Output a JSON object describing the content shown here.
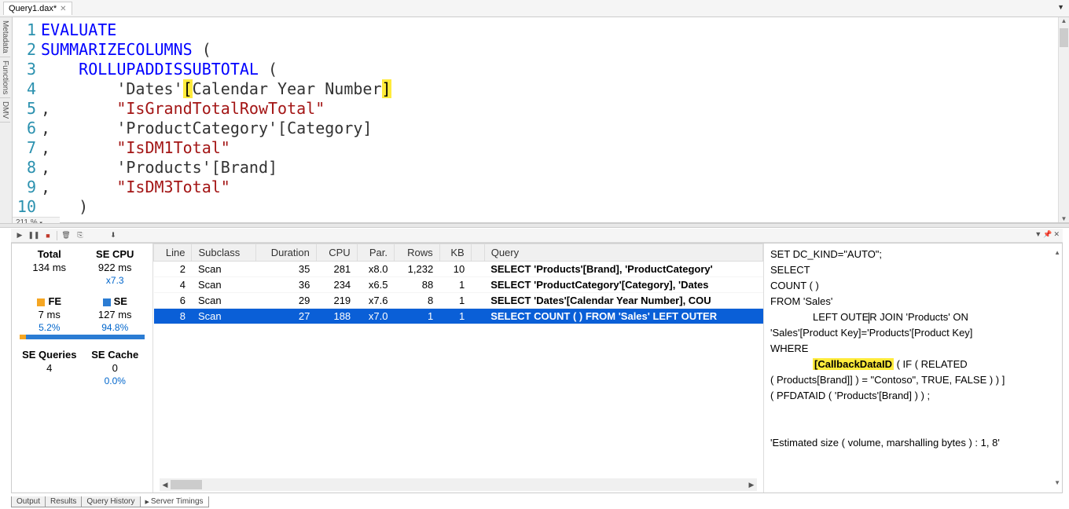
{
  "tab": {
    "title": "Query1.dax*"
  },
  "side_tabs": [
    "Metadata",
    "Functions",
    "DMV"
  ],
  "code_lines": [
    1,
    2,
    3,
    4,
    5,
    6,
    7,
    8,
    9,
    10
  ],
  "zoom": "211 %",
  "stats": {
    "total_label": "Total",
    "se_cpu_label": "SE CPU",
    "total_ms": "134 ms",
    "se_cpu_ms": "922 ms",
    "parallel": "x7.3",
    "fe_label": "FE",
    "se_label": "SE",
    "fe_ms": "7 ms",
    "se_ms": "127 ms",
    "fe_pct": "5.2%",
    "se_pct": "94.8%",
    "seq_label": "SE Queries",
    "sec_label": "SE Cache",
    "seq_val": "4",
    "sec_val": "0",
    "sec_pct": "0.0%"
  },
  "cols": {
    "line": "Line",
    "subclass": "Subclass",
    "duration": "Duration",
    "cpu": "CPU",
    "par": "Par.",
    "rows": "Rows",
    "kb": "KB",
    "query": "Query"
  },
  "rows": [
    {
      "line": "2",
      "subclass": "Scan",
      "duration": "35",
      "cpu": "281",
      "par": "x8.0",
      "rows": "1,232",
      "kb": "10",
      "query": "SELECT 'Products'[Brand], 'ProductCategory'",
      "sel": false
    },
    {
      "line": "4",
      "subclass": "Scan",
      "duration": "36",
      "cpu": "234",
      "par": "x6.5",
      "rows": "88",
      "kb": "1",
      "query": "SELECT 'ProductCategory'[Category], 'Dates",
      "sel": false
    },
    {
      "line": "6",
      "subclass": "Scan",
      "duration": "29",
      "cpu": "219",
      "par": "x7.6",
      "rows": "8",
      "kb": "1",
      "query": "SELECT 'Dates'[Calendar Year Number], COU",
      "sel": false
    },
    {
      "line": "8",
      "subclass": "Scan",
      "duration": "27",
      "cpu": "188",
      "par": "x7.0",
      "rows": "1",
      "kb": "1",
      "query": "SELECT COUNT (  )  FROM 'Sales' LEFT OUTER",
      "sel": true
    }
  ],
  "detail": {
    "l1": "SET DC_KIND=\"AUTO\";",
    "l2": "SELECT",
    "l3": "COUNT (  )",
    "l4": "FROM 'Sales'",
    "l5a": "LEFT OUTE",
    "l5b": "R JOIN 'Products' ON",
    "l6": "'Sales'[Product Key]='Products'[Product Key]",
    "l7": "WHERE",
    "l8_hl": "[CallbackDataID",
    "l8_rest": " ( IF ( RELATED",
    "l9": "( Products[Brand]] ) = \"Contoso\", TRUE, FALSE )  ) ]",
    "l10": "( PFDATAID ( 'Products'[Brand] )  ) ;",
    "l12": "'Estimated size ( volume, marshalling bytes ) : 1, 8'"
  },
  "bottom_tabs": {
    "output": "Output",
    "results": "Results",
    "history": "Query History",
    "timings": "Server Timings"
  },
  "code": {
    "l1_kw": "EVALUATE",
    "l2_kw": "SUMMARIZECOLUMNS",
    "l2_p": " (",
    "l3_kw": "ROLLUPADDISSUBTOTAL",
    "l3_p": " (",
    "l4_t": "'Dates'",
    "l4_b1": "[",
    "l4_c": "Calendar Year Number",
    "l4_b2": "]",
    "l5_c": ",",
    "l5_s": "\"IsGrandTotalRowTotal\"",
    "l6_c": ",",
    "l6_t": "'ProductCategory'",
    "l6_col": "[Category]",
    "l7_c": ",",
    "l7_s": "\"IsDM1Total\"",
    "l8_c": ",",
    "l8_t": "'Products'",
    "l8_col": "[Brand]",
    "l9_c": ",",
    "l9_s": "\"IsDM3Total\"",
    "l10_p": ")"
  }
}
